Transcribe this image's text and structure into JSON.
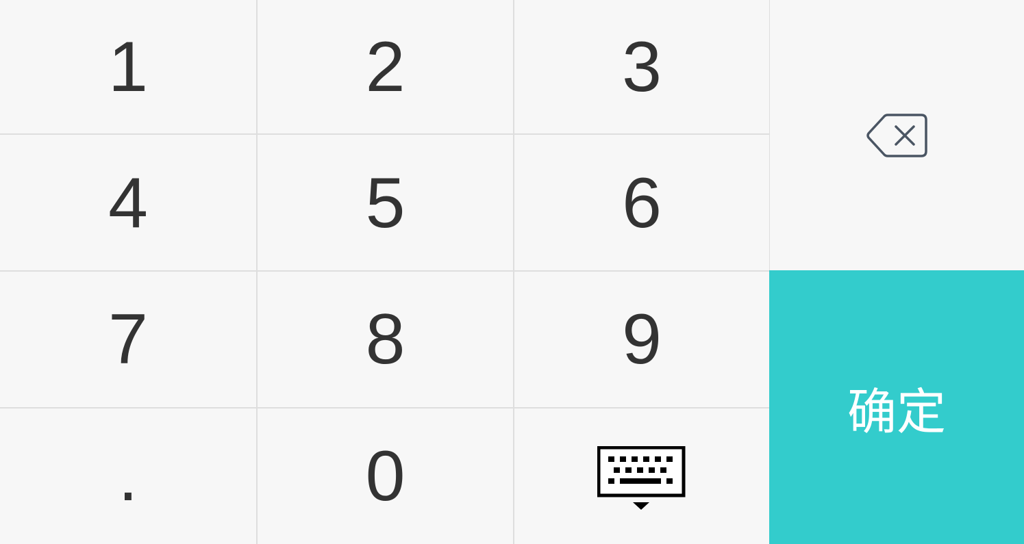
{
  "keypad": {
    "digits": {
      "k1": "1",
      "k2": "2",
      "k3": "3",
      "k4": "4",
      "k5": "5",
      "k6": "6",
      "k7": "7",
      "k8": "8",
      "k9": "9",
      "k0": "0",
      "dot": "."
    },
    "delete_icon": "backspace-icon",
    "hide_keyboard_icon": "keyboard-hide-icon",
    "confirm_label": "确定"
  },
  "colors": {
    "background": "#f7f7f7",
    "grid_line": "#dedede",
    "digit_text": "#333333",
    "confirm_bg": "#33cccc",
    "confirm_text": "#ffffff",
    "icon": "#4a5563"
  }
}
